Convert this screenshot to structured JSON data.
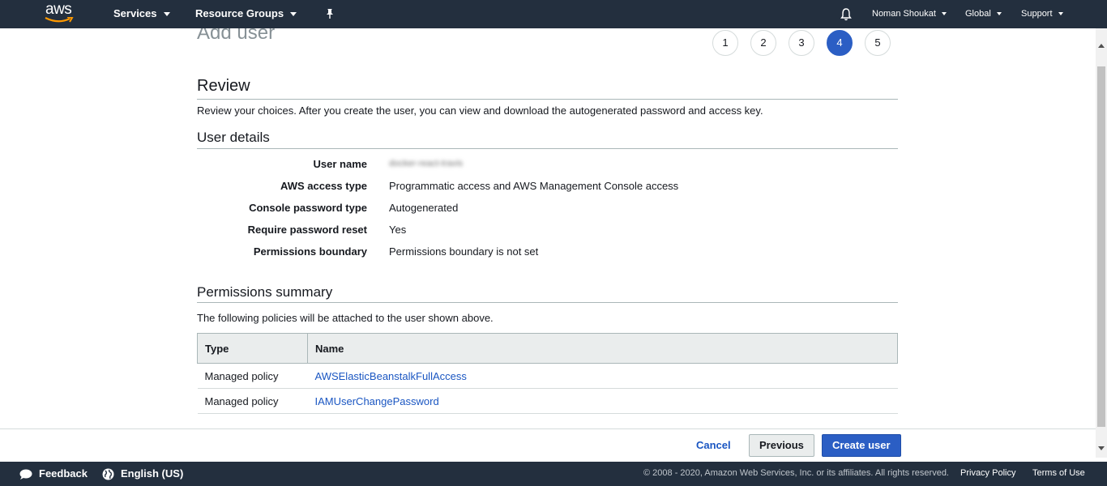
{
  "topnav": {
    "logo_text": "aws",
    "services_label": "Services",
    "resource_groups_label": "Resource Groups",
    "user_label": "Noman Shoukat",
    "region_label": "Global",
    "support_label": "Support"
  },
  "page": {
    "title": "Add user",
    "steps": [
      "1",
      "2",
      "3",
      "4",
      "5"
    ],
    "active_step": "4"
  },
  "review": {
    "heading": "Review",
    "description": "Review your choices. After you create the user, you can view and download the autogenerated password and access key."
  },
  "user_details": {
    "heading": "User details",
    "rows": [
      {
        "label": "User name",
        "value": "docker-react-travis"
      },
      {
        "label": "AWS access type",
        "value": "Programmatic access and AWS Management Console access"
      },
      {
        "label": "Console password type",
        "value": "Autogenerated"
      },
      {
        "label": "Require password reset",
        "value": "Yes"
      },
      {
        "label": "Permissions boundary",
        "value": "Permissions boundary is not set"
      }
    ]
  },
  "permissions": {
    "heading": "Permissions summary",
    "description": "The following policies will be attached to the user shown above.",
    "columns": [
      "Type",
      "Name"
    ],
    "rows": [
      {
        "type": "Managed policy",
        "name": "AWSElasticBeanstalkFullAccess"
      },
      {
        "type": "Managed policy",
        "name": "IAMUserChangePassword"
      }
    ]
  },
  "actions": {
    "cancel": "Cancel",
    "previous": "Previous",
    "create": "Create user"
  },
  "footer": {
    "feedback": "Feedback",
    "language": "English (US)",
    "copyright": "© 2008 - 2020, Amazon Web Services, Inc. or its affiliates. All rights reserved.",
    "privacy": "Privacy Policy",
    "terms": "Terms of Use"
  },
  "colors": {
    "nav_bg": "#232f3e",
    "primary": "#2b5ec4",
    "link": "#1a56c2",
    "logo_smile": "#ff9900"
  }
}
